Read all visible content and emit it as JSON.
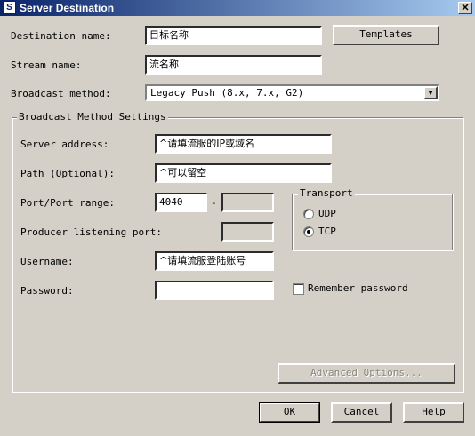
{
  "window": {
    "title": "Server Destination",
    "close": "✕"
  },
  "destination_name": {
    "label": "Destination name:",
    "value": "目标名称"
  },
  "templates_button": "Templates",
  "stream_name": {
    "label": "Stream name:",
    "value": "流名称"
  },
  "broadcast_method": {
    "label": "Broadcast method:",
    "value": "Legacy Push (8.x, 7.x, G2)"
  },
  "settings_group": {
    "title": "Broadcast Method Settings",
    "server_address": {
      "label": "Server address:",
      "value": "^请填流服的IP或域名"
    },
    "path": {
      "label": "Path (Optional):",
      "value": "^可以留空"
    },
    "port": {
      "label": "Port/Port range:",
      "value": "4040",
      "dash": "-",
      "end_value": ""
    },
    "producer_port": {
      "label": "Producer listening port:",
      "value": ""
    },
    "username": {
      "label": "Username:",
      "value": "^请填流服登陆账号"
    },
    "password": {
      "label": "Password:",
      "value": ""
    },
    "remember_password": "Remember password",
    "transport": {
      "title": "Transport",
      "options": [
        "UDP",
        "TCP"
      ],
      "selected": "TCP"
    },
    "advanced_button": "Advanced Options..."
  },
  "footer": {
    "ok": "OK",
    "cancel": "Cancel",
    "help": "Help"
  }
}
